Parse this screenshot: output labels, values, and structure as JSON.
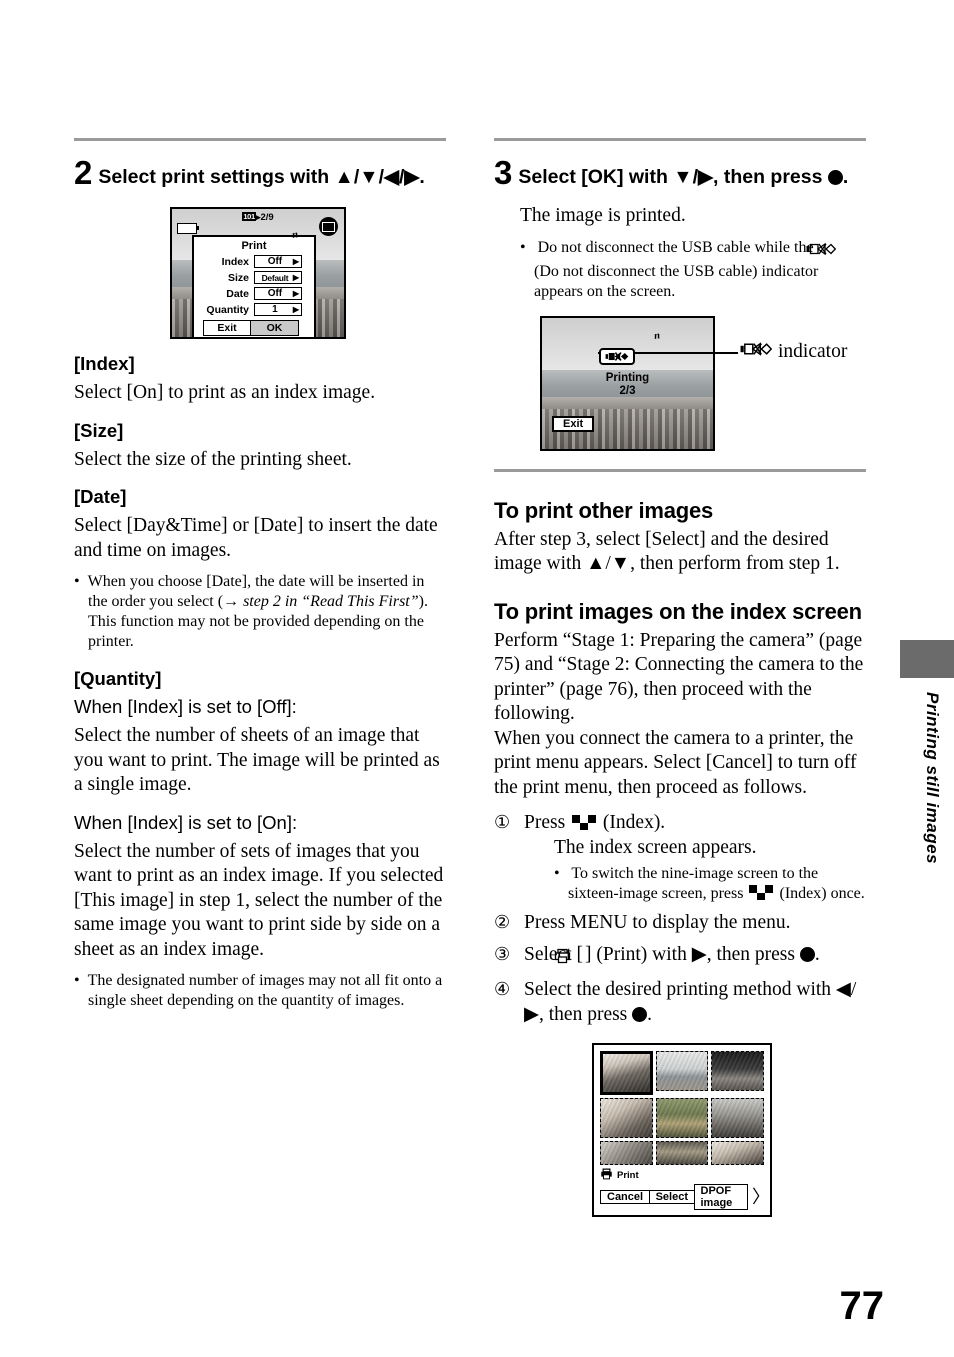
{
  "page": {
    "number": "77",
    "side_tab_label": "Printing still images"
  },
  "left_column": {
    "step": {
      "number": "2",
      "text": "Select print settings with ▲/▼/◀/▶."
    },
    "figure_print_dialog": {
      "top_info_folder": "101",
      "top_info_counter": "2/9",
      "title": "Print",
      "rows": [
        {
          "label": "Index",
          "value": "Off",
          "arrow": "▶"
        },
        {
          "label": "Size",
          "value": "Default",
          "arrow": "▶"
        },
        {
          "label": "Date",
          "value": "Off",
          "arrow": "▶"
        },
        {
          "label": "Quantity",
          "value": "1",
          "arrow": "▶"
        }
      ],
      "exit_label": "Exit",
      "ok_label": "OK"
    },
    "sections": [
      {
        "heading": "[Index]",
        "body": "Select [On] to print as an index image."
      },
      {
        "heading": "[Size]",
        "body": "Select the size of the printing sheet."
      },
      {
        "heading": "[Date]",
        "body": "Select [Day&Time] or [Date] to insert the date and time on images."
      }
    ],
    "date_note_part1": "When you choose [Date], the date will be inserted in the order you select (→ ",
    "date_note_italic": "step 2 in “Read This First”",
    "date_note_part2": "). This function may not be provided depending on the printer.",
    "quantity": {
      "heading": "[Quantity]",
      "off_heading": "When [Index] is set to [Off]:",
      "off_body": "Select the number of sheets of an image that you want to print. The image will be printed as a single image.",
      "on_heading": "When [Index] is set to [On]:",
      "on_body": "Select the number of sets of images that you want to print as an index image. If you selected [This image] in step 1, select the number of the same image you want to print side by side on a sheet as an index image.",
      "note": "The designated number of images may not all fit onto a single sheet depending on the quantity of images."
    }
  },
  "right_column": {
    "step": {
      "number": "3",
      "text_before_dot": "Select [OK] with ▼/▶, then press",
      "text_after_dot": "."
    },
    "result_text": "The image is printed.",
    "usb_note_part1": "Do not disconnect the USB cable while the",
    "usb_note_part2": "(Do not disconnect the USB cable) indicator appears on the screen.",
    "figure_printing": {
      "status_label": "Printing",
      "status_counter": "2/3",
      "exit_label": "Exit",
      "callout_label": "indicator"
    },
    "other_images": {
      "heading": "To print other images",
      "body": "After step 3, select [Select] and the desired image with ▲/▼, then perform from step 1."
    },
    "index_screen": {
      "heading": "To print images on the index screen",
      "body1": "Perform “Stage 1: Preparing the camera” (page 75) and “Stage 2: Connecting the camera to the printer” (page 76), then proceed with the following.",
      "body2": "When you connect the camera to a printer, the print menu appears. Select [Cancel] to turn off the print menu, then proceed as follows.",
      "steps": [
        {
          "num": "①",
          "text_before_icon": "Press",
          "text_after_icon": "(Index).",
          "subtext": "The index screen appears.",
          "note_before_icon": "To switch the nine-image screen to the sixteen-image screen, press",
          "note_after_icon": "(Index) once."
        },
        {
          "num": "②",
          "text": "Press MENU to display the menu."
        },
        {
          "num": "③",
          "text_before_icon": "Select [",
          "text_after_icon": "] (Print) with ▶, then press",
          "text_end": "."
        },
        {
          "num": "④",
          "text_before_dot": "Select the desired printing method with ◀/▶, then press",
          "text_after_dot": "."
        }
      ]
    },
    "figure_index_screen": {
      "menu_label": "Print",
      "buttons": [
        "Cancel",
        "Select",
        "DPOF image"
      ],
      "chevron": "〉",
      "thumbnails": [
        "people",
        "sea",
        "arch",
        "portrait",
        "dog",
        "group",
        "flower",
        "bloom",
        "girl"
      ]
    }
  },
  "colors": {
    "rule": "#9a9a9a",
    "side_tab": "#6b6b6b",
    "text": "#000000"
  }
}
